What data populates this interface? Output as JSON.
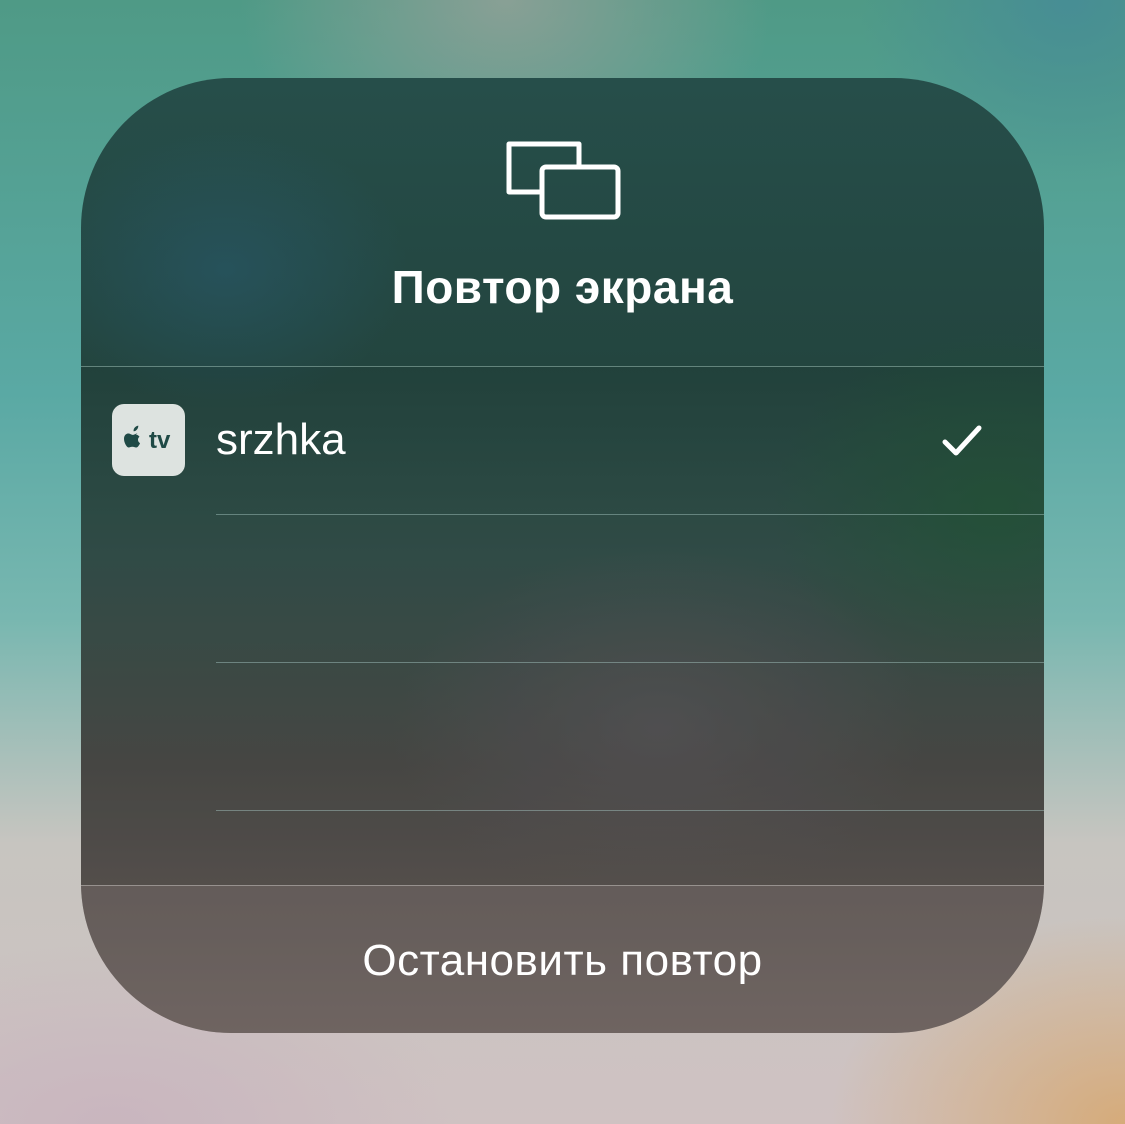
{
  "panel": {
    "icon": "screen-mirroring-icon",
    "title": "Повтор экрана"
  },
  "devices": [
    {
      "icon": "apple-tv-icon",
      "icon_text": "tv",
      "name": "srzhka",
      "selected": true,
      "status_icon": "checkmark-icon"
    }
  ],
  "footer": {
    "stop_label": "Остановить повтор"
  },
  "colors": {
    "text": "#ffffff",
    "icon_bg": "#dde3e0",
    "icon_fg": "#1f4a46"
  }
}
